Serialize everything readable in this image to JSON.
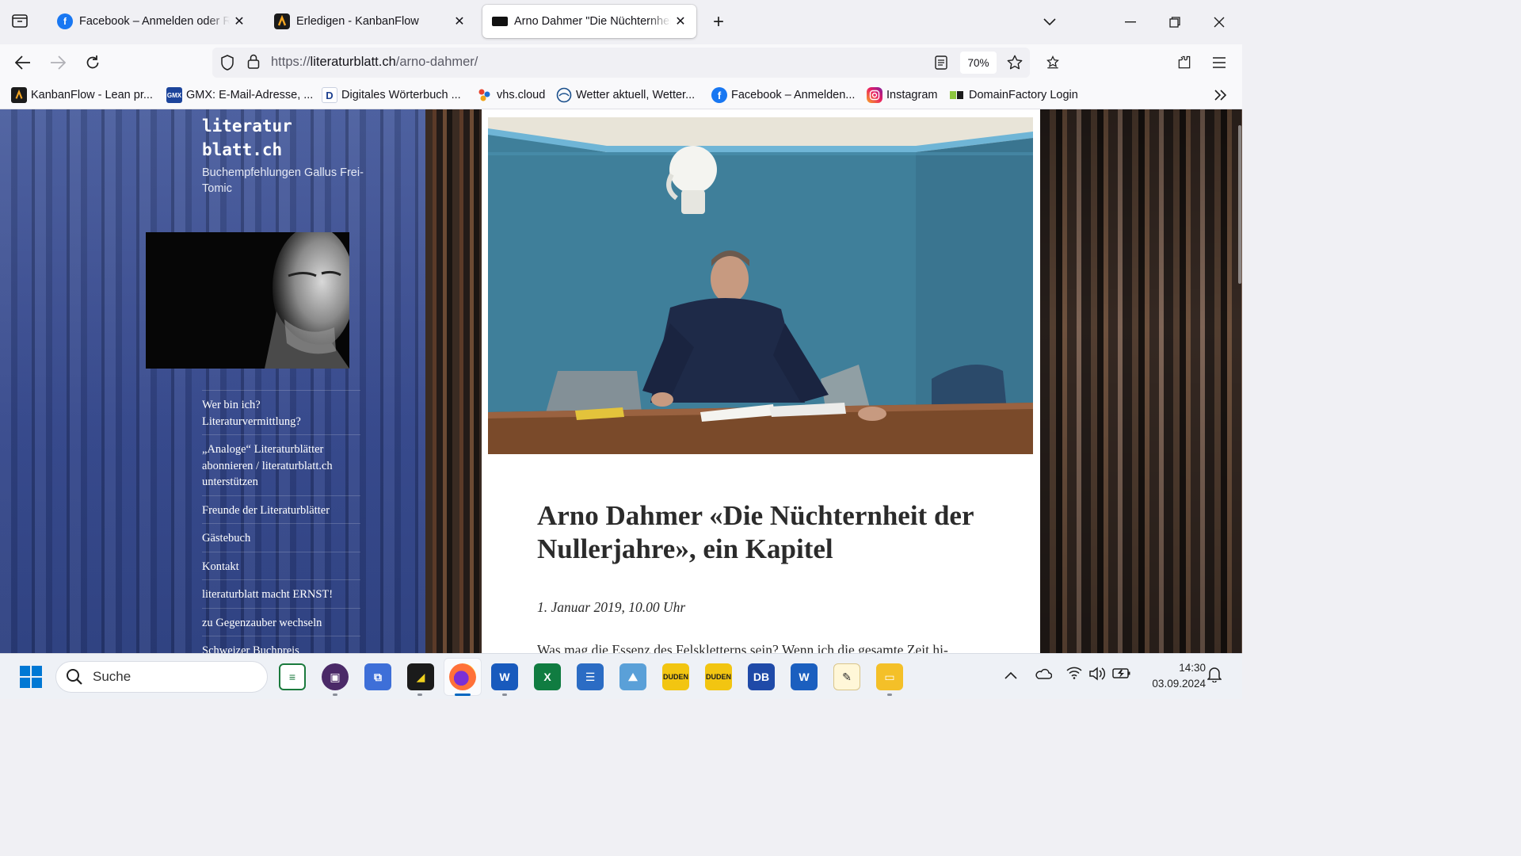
{
  "browser": {
    "tabs": [
      {
        "title": "Facebook – Anmelden oder Registrieren",
        "icon": "facebook-icon"
      },
      {
        "title": "Erledigen - KanbanFlow",
        "icon": "kanbanflow-icon"
      },
      {
        "title": "Arno Dahmer \"Die Nüchternheit der Nullerjahre\", ein Kapitel",
        "icon": "literaturblatt-icon",
        "active": true
      }
    ],
    "new_tab": "+",
    "url_scheme": "https://",
    "url_domain": "literaturblatt.ch",
    "url_path": "/arno-dahmer/",
    "zoom": "70%",
    "bookmarks": [
      {
        "label": "KanbanFlow - Lean pr...",
        "icon": "kanbanflow-icon"
      },
      {
        "label": "GMX: E-Mail-Adresse, ...",
        "icon": "gmx-icon",
        "badge": "GMX"
      },
      {
        "label": "Digitales Wörterbuch ...",
        "icon": "dwds-icon",
        "badge": "D"
      },
      {
        "label": "vhs.cloud",
        "icon": "vhs-cloud-icon"
      },
      {
        "label": "Wetter aktuell, Wetter...",
        "icon": "weather-icon"
      },
      {
        "label": "Facebook – Anmelden...",
        "icon": "facebook-icon"
      },
      {
        "label": "Instagram",
        "icon": "instagram-icon"
      },
      {
        "label": "DomainFactory Login",
        "icon": "domainfactory-icon"
      }
    ]
  },
  "site": {
    "title_line1": "literatur",
    "title_line2": "blatt.ch",
    "tagline": "Buchempfehlungen Gallus Frei-Tomic",
    "menu": [
      "Wer bin ich? Literaturvermittlung?",
      "„Analoge“ Literaturblätter abonnieren / literaturblatt.ch unterstützen",
      "Freunde der Literaturblätter",
      "Gästebuch",
      "Kontakt",
      "literaturblatt macht ERNST!",
      "zu Gegenzauber wechseln",
      "Schweizer Buchpreis"
    ]
  },
  "article": {
    "title": "Arno Dahmer «Die Nüchternheit der Nullerjahre», ein Kapitel",
    "date": "1. Januar 2019, 10.00 Uhr",
    "body_start": "Was mag die Essenz des Felskletterns sein? Wenn ich die gesamte Zeit hi-"
  },
  "taskbar": {
    "search_placeholder": "Suche",
    "time": "14:30",
    "date": "03.09.2024",
    "accent": "#0067c0"
  }
}
